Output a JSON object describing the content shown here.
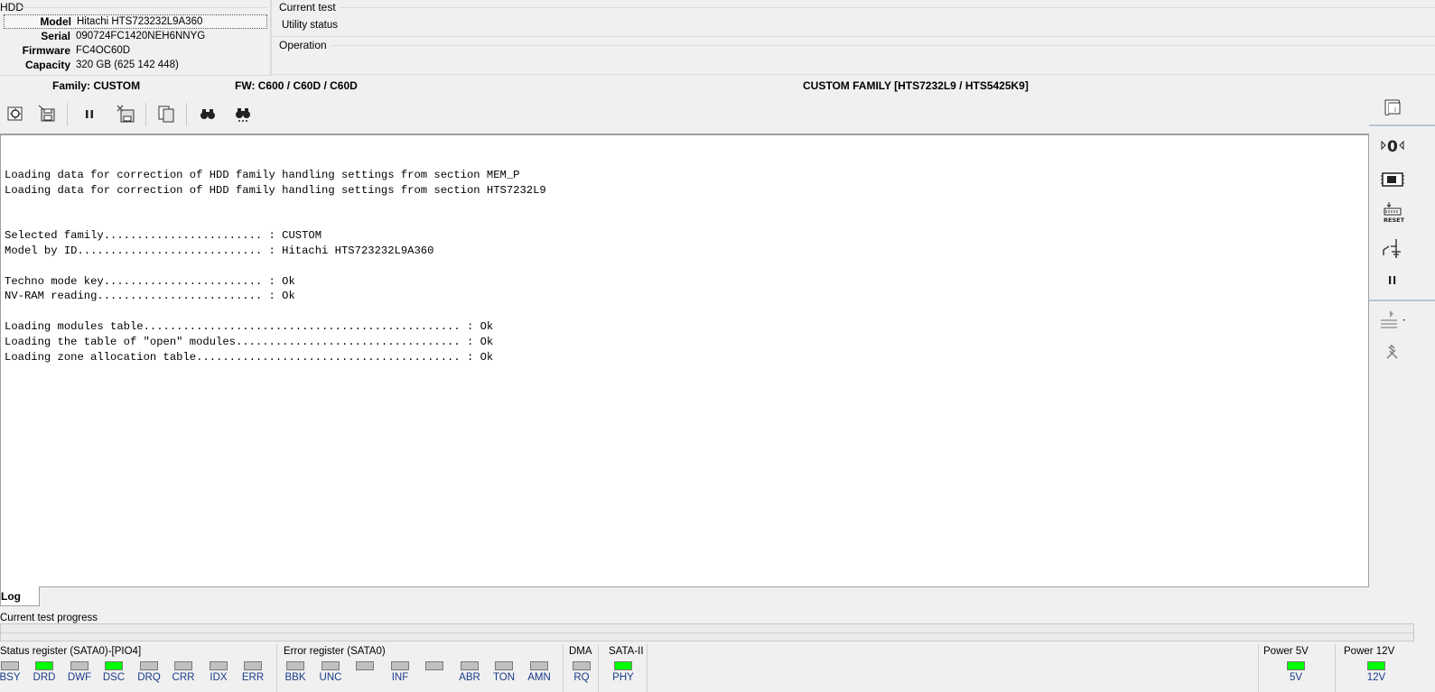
{
  "hdd": {
    "title": "HDD",
    "rows": [
      {
        "label": "Model",
        "value": "Hitachi HTS723232L9A360"
      },
      {
        "label": "Serial",
        "value": "090724FC1420NEH6NNYG"
      },
      {
        "label": "Firmware",
        "value": "FC4OC60D"
      },
      {
        "label": "Capacity",
        "value": "320 GB (625 142 448)"
      }
    ]
  },
  "current_test": {
    "title": "Current test",
    "value": "Utility status"
  },
  "operation": {
    "title": "Operation",
    "value": ""
  },
  "family_bar": {
    "family": "Family: CUSTOM",
    "fw": "FW: C600 / C60D / C60D",
    "custom": "CUSTOM FAMILY [HTS7232L9 / HTS5425K9]"
  },
  "toolbar": {
    "icons": [
      "load-config-icon",
      "save-disk-icon",
      "pause-icon",
      "delete-disk-icon",
      "copy-icon",
      "binoculars-icon",
      "binoculars-next-icon"
    ]
  },
  "log": {
    "lines": "Loading data for correction of HDD family handling settings from section MEM_P\nLoading data for correction of HDD family handling settings from section HTS7232L9\n\n\nSelected family........................ : CUSTOM\nModel by ID............................ : Hitachi HTS723232L9A360\n\nTechno mode key........................ : Ok\nNV-RAM reading......................... : Ok\n\nLoading modules table................................................ : Ok\nLoading the table of \"open\" modules.................................. : Ok\nLoading zone allocation table........................................ : Ok",
    "tab_label": "Log"
  },
  "progress": {
    "label": "Current test progress",
    "value": 0
  },
  "status_register": {
    "title": "Status register (SATA0)-[PIO4]",
    "leds": [
      {
        "name": "BSY",
        "on": false
      },
      {
        "name": "DRD",
        "on": true
      },
      {
        "name": "DWF",
        "on": false
      },
      {
        "name": "DSC",
        "on": true
      },
      {
        "name": "DRQ",
        "on": false
      },
      {
        "name": "CRR",
        "on": false
      },
      {
        "name": "IDX",
        "on": false
      },
      {
        "name": "ERR",
        "on": false
      }
    ]
  },
  "error_register": {
    "title": "Error register (SATA0)",
    "leds": [
      {
        "name": "BBK",
        "on": false
      },
      {
        "name": "UNC",
        "on": false
      },
      {
        "name": "",
        "on": false
      },
      {
        "name": "INF",
        "on": false
      },
      {
        "name": "",
        "on": false
      },
      {
        "name": "ABR",
        "on": false
      },
      {
        "name": "TON",
        "on": false
      },
      {
        "name": "AMN",
        "on": false
      }
    ]
  },
  "dma": {
    "title": "DMA",
    "led": {
      "name": "RQ",
      "on": false
    }
  },
  "sata": {
    "title": "SATA-II",
    "led": {
      "name": "PHY",
      "on": true
    }
  },
  "power5": {
    "title": "Power 5V",
    "led": {
      "name": "5V",
      "on": true
    }
  },
  "power12": {
    "title": "Power 12V",
    "led": {
      "name": "12V",
      "on": true
    }
  },
  "colors": {
    "led_on": "#00ff00",
    "led_off": "#c0c0c0",
    "led_label": "#1a3c8a"
  }
}
